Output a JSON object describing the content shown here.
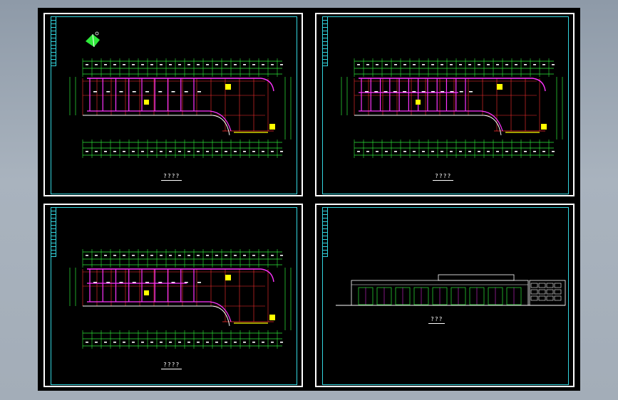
{
  "sheets": [
    {
      "caption": "????"
    },
    {
      "caption": "????"
    },
    {
      "caption": "????"
    },
    {
      "caption": "???"
    }
  ],
  "colors": {
    "background": "#000000",
    "frame": "#33d6e0",
    "grid": "#ff3030",
    "dimension": "#2eea3a",
    "wall": "#ff33ff",
    "marker": "#ffff00",
    "text": "#ffffff"
  },
  "icons": {
    "north_arrow": "north-arrow-icon"
  }
}
